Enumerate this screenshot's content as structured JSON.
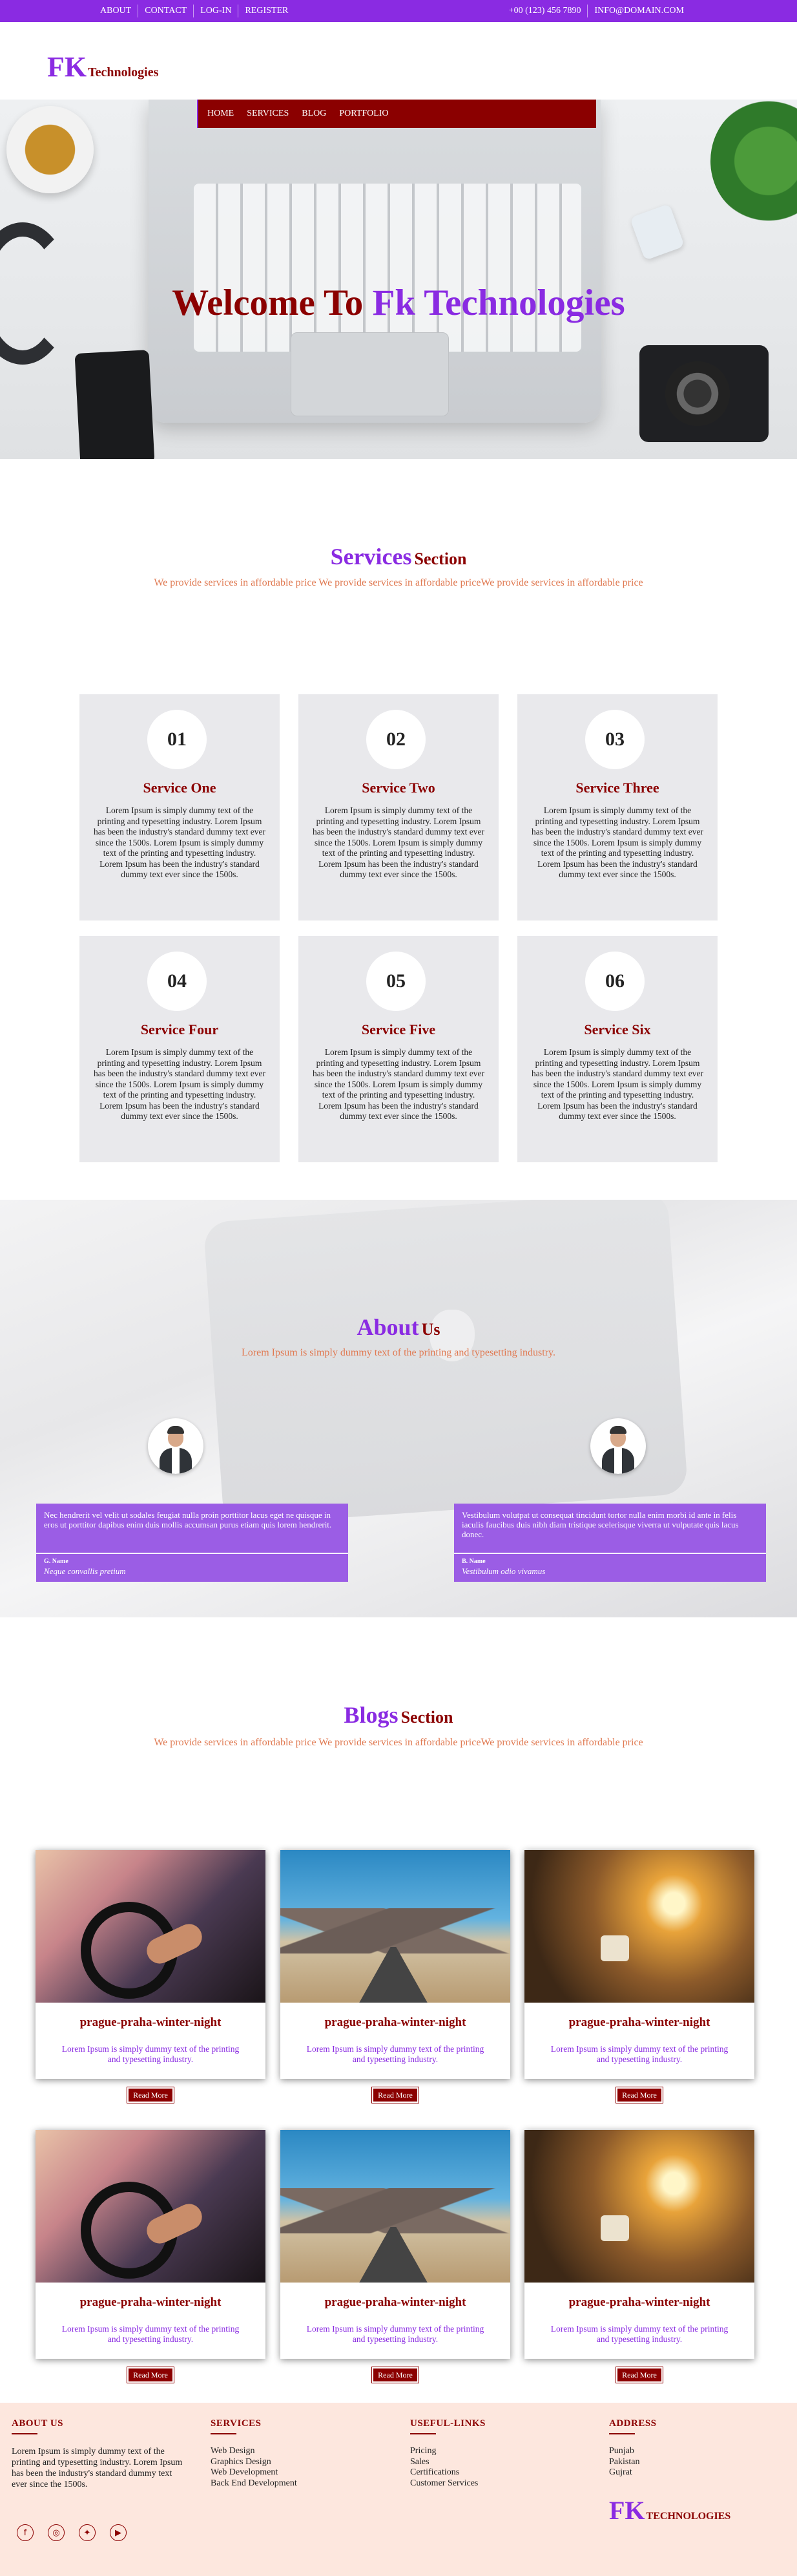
{
  "topbar": {
    "links": [
      "ABOUT",
      "CONTACT",
      "LOG-IN",
      "REGISTER"
    ],
    "phone": "+00 (123) 456 7890",
    "email": "INFO@DOMAIN.COM"
  },
  "brand": {
    "short": "FK",
    "suffix": "Technologies",
    "footer_suffix": "TECHNOLOGIES"
  },
  "nav": {
    "items": [
      "HOME",
      "SERVICES",
      "BLOG",
      "PORTFOLIO"
    ]
  },
  "hero": {
    "title_part1": "Welcome To",
    "title_part2": "Fk Technologies"
  },
  "services": {
    "title_big": "Services",
    "title_small": "Section",
    "subtitle": "We provide services in affordable price We provide services in affordable priceWe provide services in affordable price",
    "items": [
      {
        "num": "01",
        "title": "Service One",
        "text": "Lorem Ipsum is simply dummy text of the printing and typesetting industry. Lorem Ipsum has been the industry's standard dummy text ever since the 1500s. Lorem Ipsum is simply dummy text of the printing and typesetting industry. Lorem Ipsum has been the industry's standard dummy text ever since the 1500s."
      },
      {
        "num": "02",
        "title": "Service Two",
        "text": "Lorem Ipsum is simply dummy text of the printing and typesetting industry. Lorem Ipsum has been the industry's standard dummy text ever since the 1500s. Lorem Ipsum is simply dummy text of the printing and typesetting industry. Lorem Ipsum has been the industry's standard dummy text ever since the 1500s."
      },
      {
        "num": "03",
        "title": "Service Three",
        "text": "Lorem Ipsum is simply dummy text of the printing and typesetting industry. Lorem Ipsum has been the industry's standard dummy text ever since the 1500s. Lorem Ipsum is simply dummy text of the printing and typesetting industry. Lorem Ipsum has been the industry's standard dummy text ever since the 1500s."
      },
      {
        "num": "04",
        "title": "Service Four",
        "text": "Lorem Ipsum is simply dummy text of the printing and typesetting industry. Lorem Ipsum has been the industry's standard dummy text ever since the 1500s. Lorem Ipsum is simply dummy text of the printing and typesetting industry. Lorem Ipsum has been the industry's standard dummy text ever since the 1500s."
      },
      {
        "num": "05",
        "title": "Service Five",
        "text": "Lorem Ipsum is simply dummy text of the printing and typesetting industry. Lorem Ipsum has been the industry's standard dummy text ever since the 1500s. Lorem Ipsum is simply dummy text of the printing and typesetting industry. Lorem Ipsum has been the industry's standard dummy text ever since the 1500s."
      },
      {
        "num": "06",
        "title": "Service Six",
        "text": "Lorem Ipsum is simply dummy text of the printing and typesetting industry. Lorem Ipsum has been the industry's standard dummy text ever since the 1500s. Lorem Ipsum is simply dummy text of the printing and typesetting industry. Lorem Ipsum has been the industry's standard dummy text ever since the 1500s."
      }
    ]
  },
  "about": {
    "title_big": "About",
    "title_small": "Us",
    "subtitle": "Lorem Ipsum is simply dummy text of the printing and typesetting industry.",
    "testimonials": [
      {
        "text": "Nec hendrerit vel velit ut sodales feugiat nulla proin porttitor lacus eget ne quisque in eros ut porttitor dapibus enim duis mollis accumsan purus etiam quis lorem hendrerit.",
        "name": "G. Name",
        "role": "Neque convallis pretium"
      },
      {
        "text": "Vestibulum volutpat ut consequat tincidunt tortor nulla enim morbi id ante in felis iaculis faucibus duis nibh diam tristique scelerisque viverra ut vulputate quis lacus donec.",
        "name": "B. Name",
        "role": "Vestibulum odio vivamus"
      }
    ]
  },
  "blogs": {
    "title_big": "Blogs",
    "title_small": "Section",
    "subtitle": "We provide services in affordable price We provide services in affordable priceWe provide services in affordable price",
    "items": [
      {
        "title": "prague-praha-winter-night",
        "text": "Lorem Ipsum is simply dummy text of the printing and typesetting industry.",
        "button": "Read More"
      },
      {
        "title": "prague-praha-winter-night",
        "text": "Lorem Ipsum is simply dummy text of the printing and typesetting industry.",
        "button": "Read More"
      },
      {
        "title": "prague-praha-winter-night",
        "text": "Lorem Ipsum is simply dummy text of the printing and typesetting industry.",
        "button": "Read More"
      },
      {
        "title": "prague-praha-winter-night",
        "text": "Lorem Ipsum is simply dummy text of the printing and typesetting industry.",
        "button": "Read More"
      },
      {
        "title": "prague-praha-winter-night",
        "text": "Lorem Ipsum is simply dummy text of the printing and typesetting industry.",
        "button": "Read More"
      },
      {
        "title": "prague-praha-winter-night",
        "text": "Lorem Ipsum is simply dummy text of the printing and typesetting industry.",
        "button": "Read More"
      }
    ]
  },
  "footer": {
    "about": {
      "heading": "ABOUT US",
      "text": "Lorem Ipsum is simply dummy text of the printing and typesetting industry. Lorem Ipsum has been the industry's standard dummy text ever since the 1500s."
    },
    "services": {
      "heading": "SERVICES",
      "items": [
        "Web Design",
        "Graphics Design",
        "Web Development",
        "Back End Development"
      ]
    },
    "useful_links": {
      "heading": "USEFUL-LINKS",
      "items": [
        "Pricing",
        "Sales",
        "Certifications",
        "Customer Services"
      ]
    },
    "address": {
      "heading": "ADDRESS",
      "items": [
        "Punjab",
        "Pakistan",
        "Gujrat"
      ]
    },
    "social_icons": [
      "facebook-icon",
      "instagram-icon",
      "twitter-icon",
      "youtube-icon"
    ],
    "social_glyphs": [
      "f",
      "◎",
      "✦",
      "▶"
    ]
  },
  "colors": {
    "purple": "#8a2be2",
    "maroon": "#8b0000",
    "orange": "#e07a52",
    "card_bg": "#e9e9ec",
    "footer_bg": "#fde7de"
  }
}
